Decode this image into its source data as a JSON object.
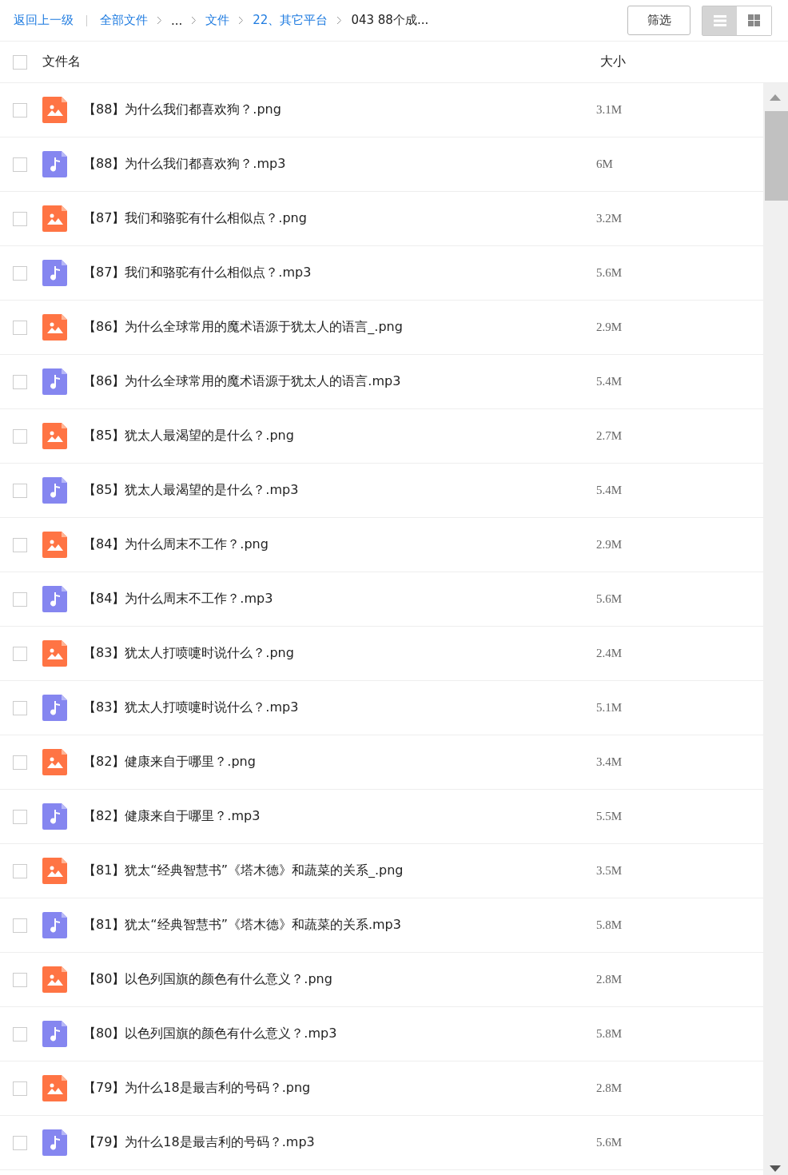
{
  "toolbar": {
    "back_link": "返回上一级",
    "breadcrumb": [
      {
        "label": "全部文件",
        "kind": "link"
      },
      {
        "label": "...",
        "kind": "text"
      },
      {
        "label": "文件",
        "kind": "link"
      },
      {
        "label": "22、其它平台",
        "kind": "link"
      },
      {
        "label": "043 88个成...",
        "kind": "text"
      }
    ],
    "filter_button": "筛选",
    "view_modes": [
      {
        "kind": "list",
        "selected": true
      },
      {
        "kind": "grid",
        "selected": false
      }
    ]
  },
  "header": {
    "checked": false,
    "columns": [
      "文件名",
      "大小"
    ]
  },
  "rows": [
    {
      "kind": "image",
      "name": "【88】为什么我们都喜欢狗？.png",
      "size": "3.1M",
      "checked": false
    },
    {
      "kind": "audio",
      "name": "【88】为什么我们都喜欢狗？.mp3",
      "size": "6M",
      "checked": false
    },
    {
      "kind": "image",
      "name": "【87】我们和骆驼有什么相似点？.png",
      "size": "3.2M",
      "checked": false
    },
    {
      "kind": "audio",
      "name": "【87】我们和骆驼有什么相似点？.mp3",
      "size": "5.6M",
      "checked": false
    },
    {
      "kind": "image",
      "name": "【86】为什么全球常用的魔术语源于犹太人的语言_.png",
      "size": "2.9M",
      "checked": false
    },
    {
      "kind": "audio",
      "name": "【86】为什么全球常用的魔术语源于犹太人的语言.mp3",
      "size": "5.4M",
      "checked": false
    },
    {
      "kind": "image",
      "name": "【85】犹太人最渴望的是什么？.png",
      "size": "2.7M",
      "checked": false
    },
    {
      "kind": "audio",
      "name": "【85】犹太人最渴望的是什么？.mp3",
      "size": "5.4M",
      "checked": false
    },
    {
      "kind": "image",
      "name": "【84】为什么周末不工作？.png",
      "size": "2.9M",
      "checked": false
    },
    {
      "kind": "audio",
      "name": "【84】为什么周末不工作？.mp3",
      "size": "5.6M",
      "checked": false
    },
    {
      "kind": "image",
      "name": "【83】犹太人打喷嚏时说什么？.png",
      "size": "2.4M",
      "checked": false
    },
    {
      "kind": "audio",
      "name": "【83】犹太人打喷嚏时说什么？.mp3",
      "size": "5.1M",
      "checked": false
    },
    {
      "kind": "image",
      "name": "【82】健康来自于哪里？.png",
      "size": "3.4M",
      "checked": false
    },
    {
      "kind": "audio",
      "name": "【82】健康来自于哪里？.mp3",
      "size": "5.5M",
      "checked": false
    },
    {
      "kind": "image",
      "name": "【81】犹太“经典智慧书”《塔木德》和蔬菜的关系_.png",
      "size": "3.5M",
      "checked": false
    },
    {
      "kind": "audio",
      "name": "【81】犹太“经典智慧书”《塔木德》和蔬菜的关系.mp3",
      "size": "5.8M",
      "checked": false
    },
    {
      "kind": "image",
      "name": "【80】以色列国旗的颜色有什么意义？.png",
      "size": "2.8M",
      "checked": false
    },
    {
      "kind": "audio",
      "name": "【80】以色列国旗的颜色有什么意义？.mp3",
      "size": "5.8M",
      "checked": false
    },
    {
      "kind": "image",
      "name": "【79】为什么18是最吉利的号码？.png",
      "size": "2.8M",
      "checked": false
    },
    {
      "kind": "audio",
      "name": "【79】为什么18是最吉利的号码？.mp3",
      "size": "5.6M",
      "checked": false
    }
  ]
}
